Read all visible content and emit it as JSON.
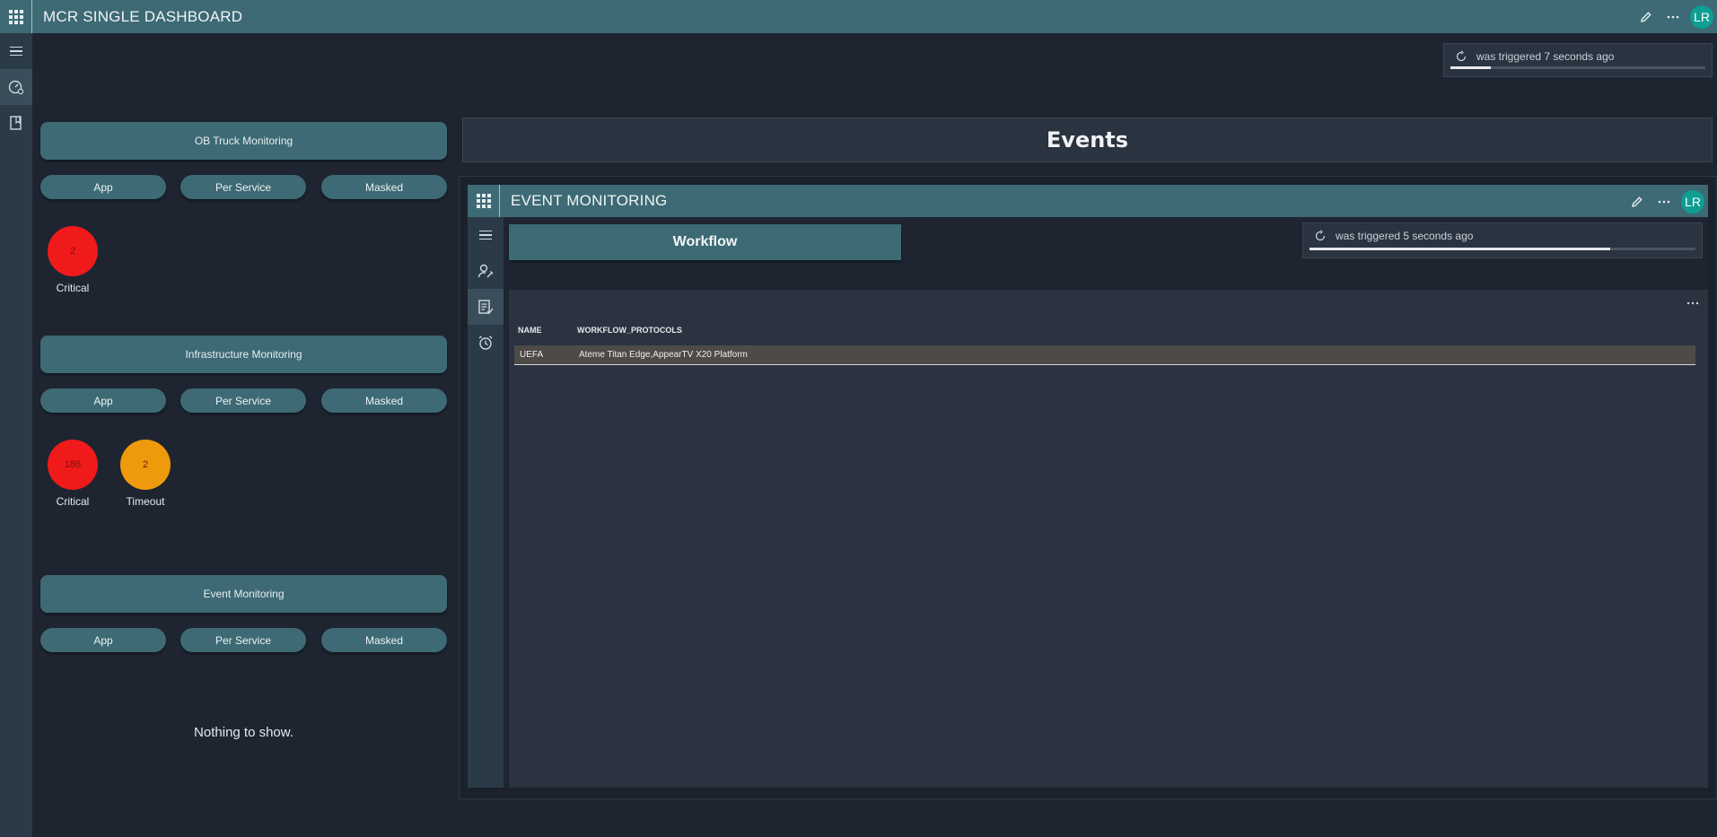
{
  "app": {
    "title": "MCR SINGLE DASHBOARD",
    "avatar_initials": "LR"
  },
  "trigger_main": {
    "text": "was triggered 7 seconds ago",
    "progress": 0.16
  },
  "left_panel": {
    "sections": [
      {
        "title": "OB Truck Monitoring",
        "pills": [
          "App",
          "Per Service",
          "Masked"
        ],
        "statuses": [
          {
            "value": "2",
            "label": "Critical",
            "color": "#f01a1a"
          }
        ]
      },
      {
        "title": "Infrastructure Monitoring",
        "pills": [
          "App",
          "Per Service",
          "Masked"
        ],
        "statuses": [
          {
            "value": "186",
            "label": "Critical",
            "color": "#f01a1a"
          },
          {
            "value": "2",
            "label": "Timeout",
            "color": "#ef9a0c"
          }
        ]
      },
      {
        "title": "Event Monitoring",
        "pills": [
          "App",
          "Per Service",
          "Masked"
        ],
        "empty_text": "Nothing to show."
      }
    ]
  },
  "events": {
    "header": "Events",
    "embedded": {
      "title": "EVENT MONITORING",
      "avatar_initials": "LR",
      "workflow_button": "Workflow",
      "trigger": {
        "text": "was triggered 5 seconds ago",
        "progress": 0.78
      },
      "table": {
        "columns": [
          "NAME",
          "WORKFLOW_PROTOCOLS"
        ],
        "rows": [
          [
            "UEFA",
            "Ateme Titan Edge,AppearTV X20 Platform"
          ]
        ]
      }
    }
  }
}
